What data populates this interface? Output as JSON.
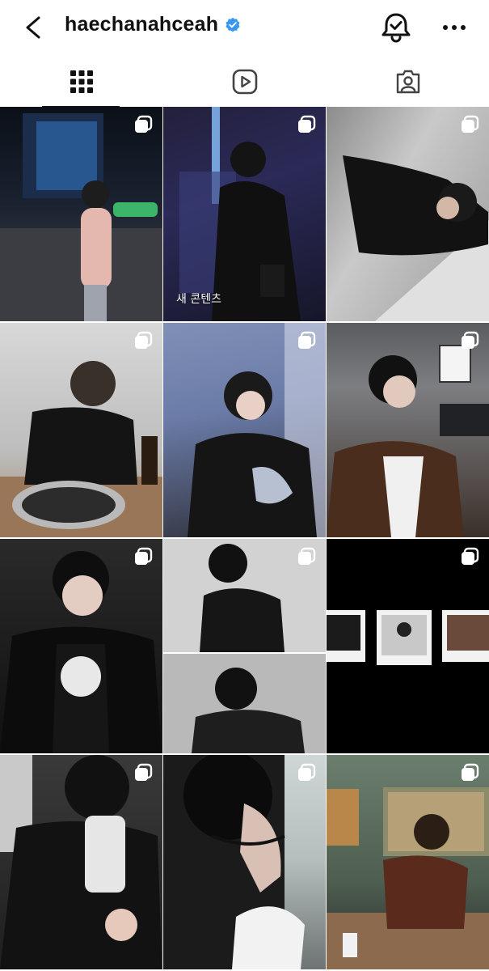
{
  "header": {
    "username": "haechanahceah",
    "back_icon": "chevron-left-icon",
    "verified_icon": "verified-badge-icon",
    "notification_icon": "bell-check-icon",
    "more_icon": "more-horizontal-icon"
  },
  "tabs": [
    {
      "icon": "grid-icon",
      "active": true
    },
    {
      "icon": "reels-icon",
      "active": false
    },
    {
      "icon": "tagged-icon",
      "active": false
    }
  ],
  "posts": [
    {
      "id": 1,
      "multi": true,
      "caption": ""
    },
    {
      "id": 2,
      "multi": true,
      "caption": "새 콘텐츠"
    },
    {
      "id": 3,
      "multi": true,
      "caption": ""
    },
    {
      "id": 4,
      "multi": true,
      "caption": ""
    },
    {
      "id": 5,
      "multi": true,
      "caption": ""
    },
    {
      "id": 6,
      "multi": true,
      "caption": ""
    },
    {
      "id": 7,
      "multi": true,
      "caption": ""
    },
    {
      "id": 8,
      "multi": true,
      "caption": ""
    },
    {
      "id": 9,
      "multi": true,
      "caption": ""
    },
    {
      "id": 10,
      "multi": true,
      "caption": ""
    },
    {
      "id": 11,
      "multi": true,
      "caption": ""
    },
    {
      "id": 12,
      "multi": true,
      "caption": ""
    }
  ],
  "colors": {
    "accent": "#3897f0",
    "text": "#111111"
  }
}
